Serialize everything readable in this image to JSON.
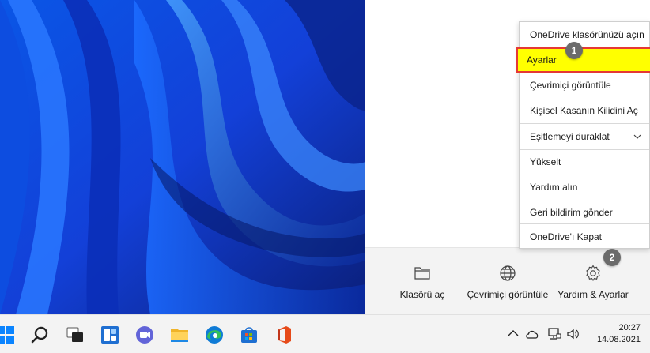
{
  "menu": {
    "items": [
      {
        "label": "OneDrive klasörünüzü açın"
      },
      {
        "label": "Ayarlar"
      },
      {
        "label": "Çevrimiçi görüntüle"
      },
      {
        "label": "Kişisel Kasanın Kilidini Aç"
      },
      {
        "label": "Eşitlemeyi duraklat"
      },
      {
        "label": "Yükselt"
      },
      {
        "label": "Yardım alın"
      },
      {
        "label": "Geri bildirim gönder"
      },
      {
        "label": "OneDrive'ı Kapat"
      }
    ],
    "highlight_color": "#ffff00",
    "highlight_border_color": "#e53935"
  },
  "badges": {
    "step1": "1",
    "step2": "2"
  },
  "flyout": {
    "buttons": [
      {
        "label": "Klasörü aç",
        "icon": "folder-icon"
      },
      {
        "label": "Çevrimiçi görüntüle",
        "icon": "globe-icon"
      },
      {
        "label": "Yardım & Ayarlar",
        "icon": "gear-icon"
      }
    ]
  },
  "taskbar": {
    "apps": [
      "start-icon",
      "search-icon",
      "task-view-icon",
      "widgets-icon",
      "chat-icon",
      "file-explorer-icon",
      "edge-icon",
      "store-icon",
      "office-icon"
    ],
    "tray": [
      "chevron-up-icon",
      "onedrive-cloud-icon",
      "network-icon",
      "volume-icon"
    ],
    "clock": {
      "time": "20:27",
      "date": "14.08.2021"
    }
  },
  "colors": {
    "accent": "#0a5ad8",
    "wallpaper_base": "#0b3fd0"
  }
}
